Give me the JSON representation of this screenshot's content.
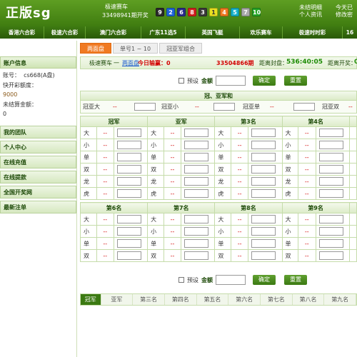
{
  "header": {
    "logo": "正版sg",
    "game_name": "极速赛车",
    "issue": "33498941期开奖",
    "balls": [
      {
        "n": "9",
        "color": "#2a2a2a"
      },
      {
        "n": "2",
        "color": "#1e64d8"
      },
      {
        "n": "6",
        "color": "#2a2a8a"
      },
      {
        "n": "8",
        "color": "#d42020"
      },
      {
        "n": "3",
        "color": "#3a3a3a"
      },
      {
        "n": "1",
        "color": "#e8e020"
      },
      {
        "n": "4",
        "color": "#f07a22"
      },
      {
        "n": "5",
        "color": "#16b0c8"
      },
      {
        "n": "7",
        "color": "#aaaaaa"
      },
      {
        "n": "10",
        "color": "#26a626"
      }
    ],
    "link_unsettled": "未结明细",
    "link_personal": "个人资讯",
    "link_today": "今天已",
    "link_password": "修改密"
  },
  "nav": [
    "香港六合彩",
    "极速六合彩",
    "澳门六合彩",
    "广东11选5",
    "英国飞艇",
    "欢乐赛车",
    "极速时时彩",
    "16"
  ],
  "sidebar": {
    "account_title": "账户信息",
    "account_label": "账号：",
    "account_value": "cs668(A盘)",
    "quick_label": "快开彩额度：",
    "quick_value": "9000",
    "unsettled_label": "未结算金额：",
    "unsettled_value": "0",
    "items": [
      "我的团队",
      "个人中心",
      "在线充值",
      "在线提款",
      "全国开奖网",
      "最新注单"
    ]
  },
  "tabs": [
    "两面盘",
    "单号1 ~ 10",
    "冠亚军组合"
  ],
  "info": {
    "game": "极速赛车",
    "dash": "一",
    "mode": "两面盘",
    "today_label": "今日输赢：",
    "today_value": "0",
    "issue": "33504866期",
    "close_label": "距离封盘：",
    "close_time": "536:40:05",
    "draw_label": "距离开奖：",
    "draw_value": "0"
  },
  "amount": {
    "preset": "预设",
    "label": "金额",
    "confirm": "确定",
    "reset": "重置"
  },
  "gy": {
    "title": "冠、亚军和",
    "items": [
      {
        "label": "冠亚大",
        "odds": "--"
      },
      {
        "label": "冠亚小",
        "odds": "--"
      },
      {
        "label": "冠亚单",
        "odds": "--"
      },
      {
        "label": "冠亚双",
        "odds": "--"
      }
    ]
  },
  "block1": {
    "cols": [
      "冠军",
      "亚军",
      "第3名",
      "第4名"
    ],
    "rows": [
      "大",
      "小",
      "单",
      "双",
      "龙",
      "虎"
    ],
    "odds": "--"
  },
  "block2": {
    "cols": [
      "第6名",
      "第7名",
      "第8名",
      "第9名"
    ],
    "rows": [
      "大",
      "小",
      "单",
      "双"
    ],
    "odds": "--"
  },
  "bottom_tabs": [
    "冠军",
    "亚军",
    "第三名",
    "第四名",
    "第五名",
    "第六名",
    "第七名",
    "第八名",
    "第九名"
  ]
}
